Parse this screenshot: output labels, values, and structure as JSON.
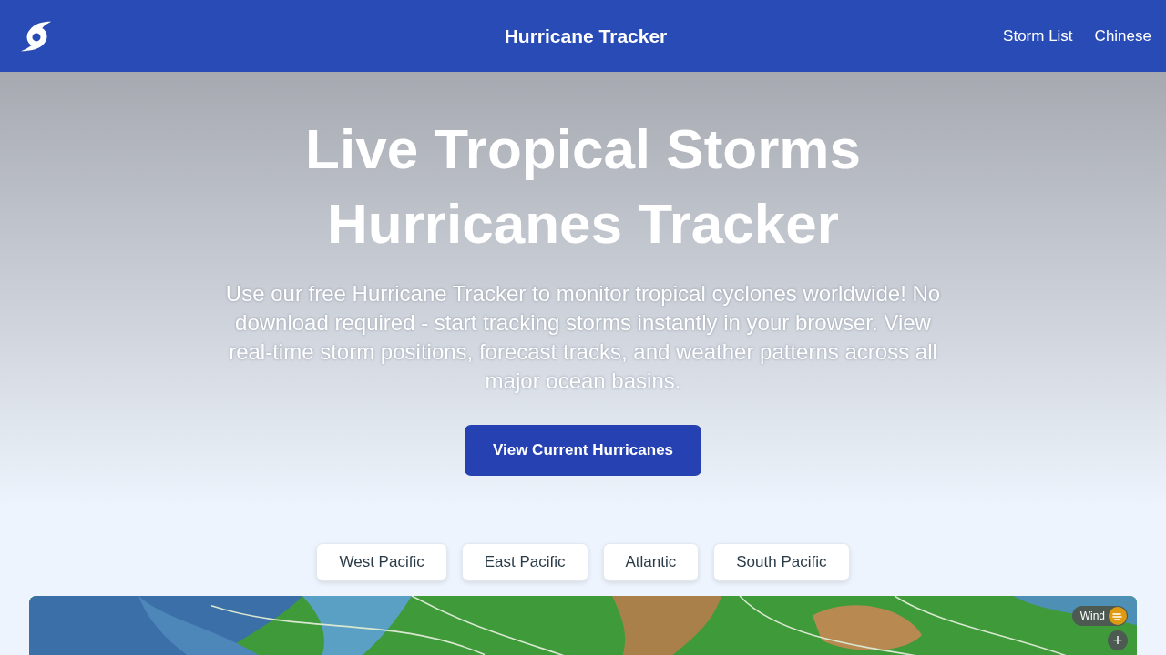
{
  "header": {
    "title": "Hurricane Tracker",
    "nav": [
      {
        "label": "Storm List"
      },
      {
        "label": "Chinese"
      }
    ]
  },
  "hero": {
    "title_lines": [
      "Live Tropical Storms",
      "Hurricanes Tracker"
    ],
    "description": "Use our free Hurricane Tracker to monitor tropical cyclones worldwide! No download required - start tracking storms instantly in your browser. View real-time storm positions, forecast tracks, and weather patterns across all major ocean basins.",
    "button": "View Current Hurricanes"
  },
  "basins": [
    {
      "label": "West Pacific"
    },
    {
      "label": "East Pacific"
    },
    {
      "label": "Atlantic"
    },
    {
      "label": "South Pacific"
    }
  ],
  "map": {
    "kind": "picture",
    "layer_button": "Wind",
    "zoom_button": "+"
  }
}
